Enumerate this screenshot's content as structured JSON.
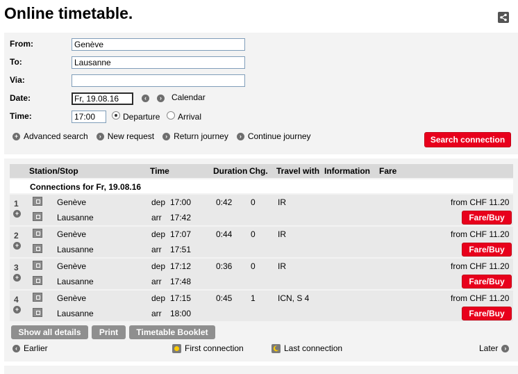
{
  "page": {
    "title": "Online timetable."
  },
  "form": {
    "from_label": "From:",
    "from_value": "Genève",
    "to_label": "To:",
    "to_value": "Lausanne",
    "via_label": "Via:",
    "via_value": "",
    "date_label": "Date:",
    "date_value": "Fr, 19.08.16",
    "calendar_label": "Calendar",
    "time_label": "Time:",
    "time_value": "17:00",
    "departure_label": "Departure",
    "arrival_label": "Arrival",
    "selected_mode": "Departure",
    "links": [
      "Advanced search",
      "New request",
      "Return journey",
      "Continue journey"
    ],
    "search_button": "Search connection"
  },
  "results": {
    "headers": {
      "station": "Station/Stop",
      "time": "Time",
      "duration": "Duration",
      "changes": "Chg.",
      "travel": "Travel with",
      "information": "Information",
      "fare": "Fare"
    },
    "connections_for": "Connections for Fr, 19.08.16",
    "connections": [
      {
        "num": "1",
        "from": "Genève",
        "to": "Lausanne",
        "dep_label": "dep",
        "dep": "17:00",
        "arr_label": "arr",
        "arr": "17:42",
        "duration": "0:42",
        "changes": "0",
        "travel": "IR",
        "fare": "from CHF 11.20",
        "buy": "Fare/Buy"
      },
      {
        "num": "2",
        "from": "Genève",
        "to": "Lausanne",
        "dep_label": "dep",
        "dep": "17:07",
        "arr_label": "arr",
        "arr": "17:51",
        "duration": "0:44",
        "changes": "0",
        "travel": "IR",
        "fare": "from CHF 11.20",
        "buy": "Fare/Buy"
      },
      {
        "num": "3",
        "from": "Genève",
        "to": "Lausanne",
        "dep_label": "dep",
        "dep": "17:12",
        "arr_label": "arr",
        "arr": "17:48",
        "duration": "0:36",
        "changes": "0",
        "travel": "IR",
        "fare": "from CHF 11.20",
        "buy": "Fare/Buy"
      },
      {
        "num": "4",
        "from": "Genève",
        "to": "Lausanne",
        "dep_label": "dep",
        "dep": "17:15",
        "arr_label": "arr",
        "arr": "18:00",
        "duration": "0:45",
        "changes": "1",
        "travel": "ICN, S 4",
        "fare": "from CHF 11.20",
        "buy": "Fare/Buy"
      }
    ],
    "buttons": {
      "show_all": "Show all details",
      "print": "Print",
      "booklet": "Timetable Booklet"
    },
    "nav": {
      "earlier": "Earlier",
      "first": "First connection",
      "last": "Last connection",
      "later": "Later"
    }
  },
  "colors": {
    "accent_red": "#e8001c",
    "panel_bg": "#f3f3f3",
    "row_bg": "#e9e9e9",
    "header_bg": "#d9d9d9",
    "gray_button": "#8f8f8f"
  },
  "icons": {
    "share": "share-icon",
    "prev": "chevron-left-icon",
    "next": "chevron-right-icon",
    "expand": "plus-icon",
    "station": "station-icon",
    "sun": "sun-icon",
    "moon": "moon-icon"
  }
}
